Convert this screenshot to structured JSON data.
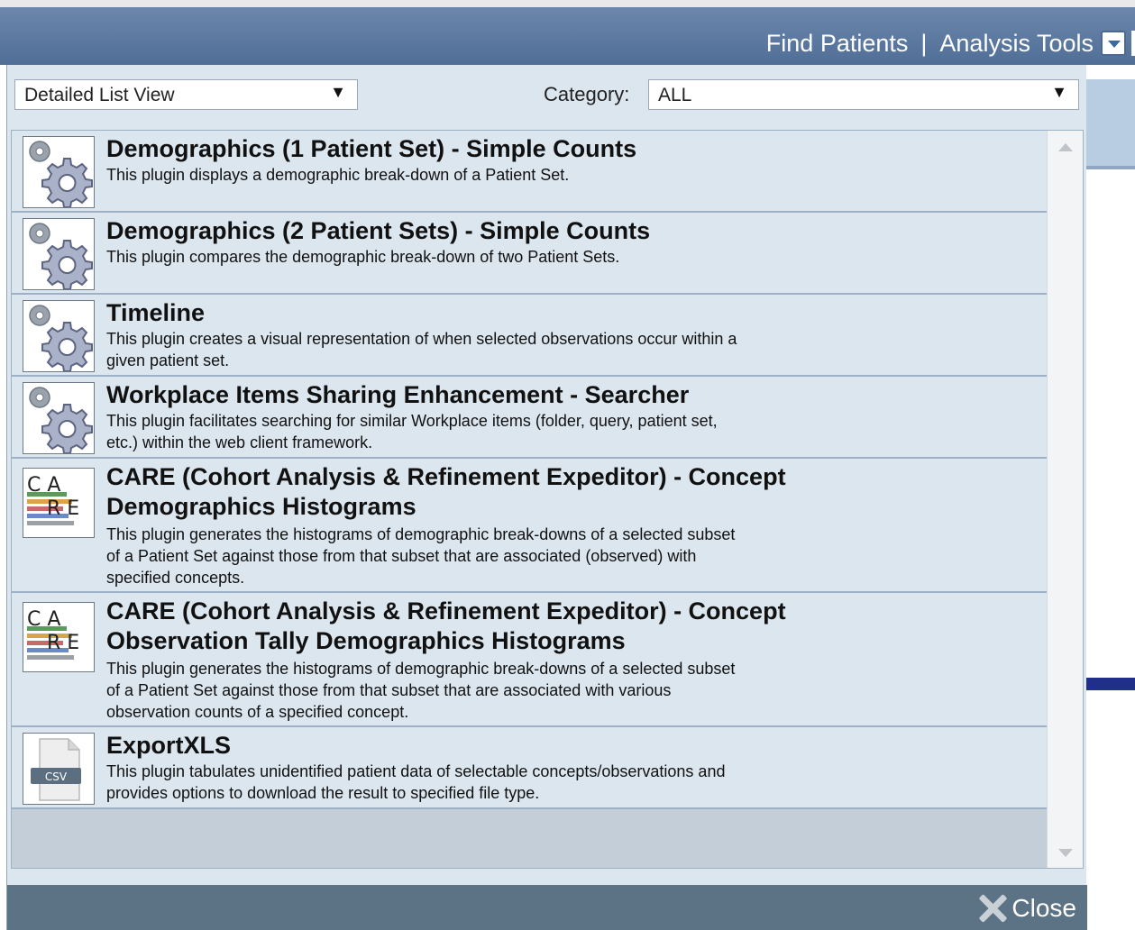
{
  "topnav": {
    "find_patients": "Find Patients",
    "separator": "|",
    "analysis_tools": "Analysis Tools"
  },
  "controls": {
    "view_select_value": "Detailed List View",
    "category_label": "Category:",
    "category_select_value": "ALL"
  },
  "plugins": [
    {
      "icon": "gear-icon",
      "title": "Demographics (1 Patient Set) - Simple Counts",
      "desc_lines": [
        "This plugin displays a demographic break-down of a Patient Set."
      ]
    },
    {
      "icon": "gear-icon",
      "title": "Demographics (2 Patient Sets) - Simple Counts",
      "desc_lines": [
        "This plugin compares the demographic break-down of two Patient Sets."
      ]
    },
    {
      "icon": "gear-icon",
      "title": "Timeline",
      "desc_lines": [
        "This plugin creates a visual representation of when selected observations occur within a",
        "given patient set."
      ]
    },
    {
      "icon": "gear-icon",
      "title": "Workplace Items Sharing Enhancement - Searcher",
      "desc_lines": [
        "This plugin facilitates searching for similar Workplace items (folder, query, patient set,",
        "etc.) within the web client framework."
      ]
    },
    {
      "icon": "care-icon",
      "title_lines": [
        "CARE (Cohort Analysis & Refinement Expeditor) - Concept",
        "Demographics Histograms"
      ],
      "desc_lines": [
        "This plugin generates the histograms of demographic break-downs of a selected subset",
        "of a Patient Set against those from that subset that are associated (observed) with",
        "specified concepts."
      ]
    },
    {
      "icon": "care-icon",
      "title_lines": [
        "CARE (Cohort Analysis & Refinement Expeditor) - Concept",
        "Observation Tally Demographics Histograms"
      ],
      "desc_lines": [
        "This plugin generates the histograms of demographic break-downs of a selected subset",
        "of a Patient Set against those from that subset that are associated with various",
        "observation counts of a specified concept."
      ]
    },
    {
      "icon": "csv-icon",
      "title": "ExportXLS",
      "desc_lines": [
        "This plugin tabulates unidentified patient data of selectable concepts/observations and",
        "provides options to download the result to specified file type."
      ]
    }
  ],
  "care_icon_text": {
    "top": "C A",
    "bottom": "R E"
  },
  "csv_icon_text": "CSV",
  "footer": {
    "close_label": "Close"
  },
  "colors": {
    "header": "#5b779e",
    "dialog_bg": "#dce6ef",
    "footer": "#5c7285"
  }
}
